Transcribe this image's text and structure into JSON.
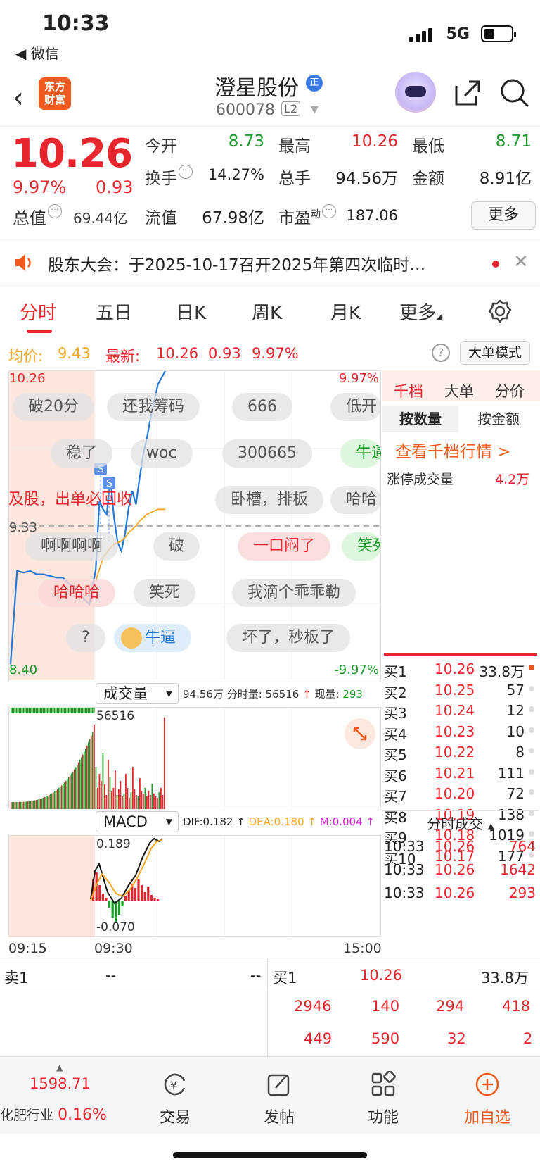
{
  "status_bar": {
    "time": "10:33",
    "back_app": "◀ 微信",
    "network": "5G"
  },
  "header": {
    "logo_line1": "东方",
    "logo_line2": "财富",
    "stock_name": "澄星股份",
    "badge": "正",
    "stock_code": "600078",
    "level": "L2"
  },
  "quote": {
    "price": "10.26",
    "change_pct": "9.97%",
    "change": "0.93",
    "market_value_label": "总值",
    "market_value": "69.44亿",
    "open_label": "今开",
    "open": "8.73",
    "high_label": "最高",
    "high": "10.26",
    "low_label": "最低",
    "low": "8.71",
    "turnover_label": "换手",
    "turnover": "14.27%",
    "volume_label": "总手",
    "volume": "94.56万",
    "amount_label": "金额",
    "amount": "8.91亿",
    "float_label": "流值",
    "float_value": "67.98亿",
    "pe_label": "市盈",
    "pe_sup": "动",
    "pe": "187.06",
    "more_label": "更多"
  },
  "notice": {
    "text": "股东大会：于2025-10-17召开2025年第四次临时…"
  },
  "tabs": [
    "分时",
    "五日",
    "日K",
    "周K",
    "月K",
    "更多"
  ],
  "summary_line": {
    "avg_label": "均价:",
    "avg": "9.43",
    "latest_label": "最新:",
    "latest": "10.26",
    "change": "0.93",
    "pct": "9.97%",
    "big_order_mode": "大单模式"
  },
  "chart_data": {
    "type": "line",
    "title": "",
    "y_top_label": "10.26",
    "y_mid_label": "9.33",
    "y_bottom_label": "8.40",
    "pct_top_label": "9.97%",
    "pct_bottom_label": "-9.97%",
    "ylim": [
      8.4,
      10.26
    ],
    "prev_close": 9.33,
    "x_ticks": [
      "09:15",
      "09:30",
      "15:00"
    ],
    "series": [
      {
        "values": [
          8.5,
          9.06,
          9.05,
          9.06,
          9.04,
          9.04,
          9.03,
          9.02,
          9.02,
          8.98,
          8.96,
          8.9,
          8.86,
          9.07,
          9.48,
          9.43,
          9.4,
          9.62,
          9.38,
          9.23,
          9.18,
          9.28,
          9.44,
          9.54,
          9.46,
          9.62,
          9.76,
          9.86,
          9.98,
          10.08,
          10.18,
          10.22,
          10.26
        ]
      },
      {
        "values": [
          null,
          null,
          null,
          null,
          null,
          null,
          null,
          null,
          null,
          null,
          null,
          null,
          null,
          9.0,
          9.07,
          9.14,
          9.17,
          9.2,
          9.22,
          9.23,
          9.24,
          9.26,
          9.29,
          9.31,
          9.33,
          9.36,
          9.38,
          9.4,
          9.41,
          9.42,
          9.43,
          9.43,
          9.43
        ]
      }
    ]
  },
  "danmu": [
    "破20分",
    "还我筹码",
    "666",
    "低开",
    "稳了",
    "woc",
    "300665",
    "牛逼",
    "及股，出单必回收",
    "卧槽，排板",
    "哈哈",
    "啊啊啊啊",
    "破",
    "一口闷了",
    "笑死",
    "哈哈哈",
    "笑死",
    "我滴个乖乖勒",
    "?",
    "牛逼",
    "坏了，秒板了"
  ],
  "volume_panel": {
    "label": "成交量",
    "total": "94.56万",
    "minute_label": "分时量:",
    "minute": "56516",
    "now_label": "现量:",
    "now": "293",
    "peak_label": "56516"
  },
  "macd_panel": {
    "label": "MACD",
    "dif": "DIF:0.182",
    "dea": "DEA:0.180",
    "m": "M:0.004",
    "top_label": "0.189",
    "bottom_label": "-0.070"
  },
  "right_panel": {
    "tabs": [
      "千档",
      "大单",
      "分价"
    ],
    "subtabs": [
      "按数量",
      "按金额"
    ],
    "view_link": "查看千档行情 >",
    "limit_label": "涨停成交量",
    "limit_value": "4.2万",
    "bids": [
      {
        "label": "买1",
        "price": "10.26",
        "qty": "33.8万"
      },
      {
        "label": "买2",
        "price": "10.25",
        "qty": "57"
      },
      {
        "label": "买3",
        "price": "10.24",
        "qty": "12"
      },
      {
        "label": "买4",
        "price": "10.23",
        "qty": "10"
      },
      {
        "label": "买5",
        "price": "10.22",
        "qty": "8"
      },
      {
        "label": "买6",
        "price": "10.21",
        "qty": "111"
      },
      {
        "label": "买7",
        "price": "10.20",
        "qty": "72"
      },
      {
        "label": "买8",
        "price": "10.19",
        "qty": "138"
      },
      {
        "label": "买9",
        "price": "10.18",
        "qty": "1019"
      },
      {
        "label": "买10",
        "price": "10.17",
        "qty": "177"
      }
    ],
    "ticks_title": "分时成交",
    "ticks": [
      {
        "time": "10:33",
        "price": "10.26",
        "qty": "764"
      },
      {
        "time": "10:33",
        "price": "10.26",
        "qty": "1642"
      },
      {
        "time": "10:33",
        "price": "10.26",
        "qty": "293"
      }
    ]
  },
  "bottom_quote": {
    "sell1_label": "卖1",
    "sell1_price": "--",
    "sell1_qty": "--",
    "buy1_label": "买1",
    "buy1_price": "10.26",
    "buy1_qty": "33.8万",
    "row2": [
      "2946",
      "140",
      "294",
      "418"
    ],
    "row3": [
      "449",
      "590",
      "32",
      "2"
    ]
  },
  "bottom_nav": {
    "index_value": "1598.71",
    "industry": "化肥行业",
    "industry_pct": "0.16%",
    "trade": "交易",
    "post": "发帖",
    "functions": "功能",
    "watchlist": "加自选"
  },
  "colors": {
    "up": "#e8242c",
    "down": "#1b9a2a",
    "avg_line": "#f5a623",
    "price_line": "#2577d8",
    "accent": "#f05a1e"
  }
}
